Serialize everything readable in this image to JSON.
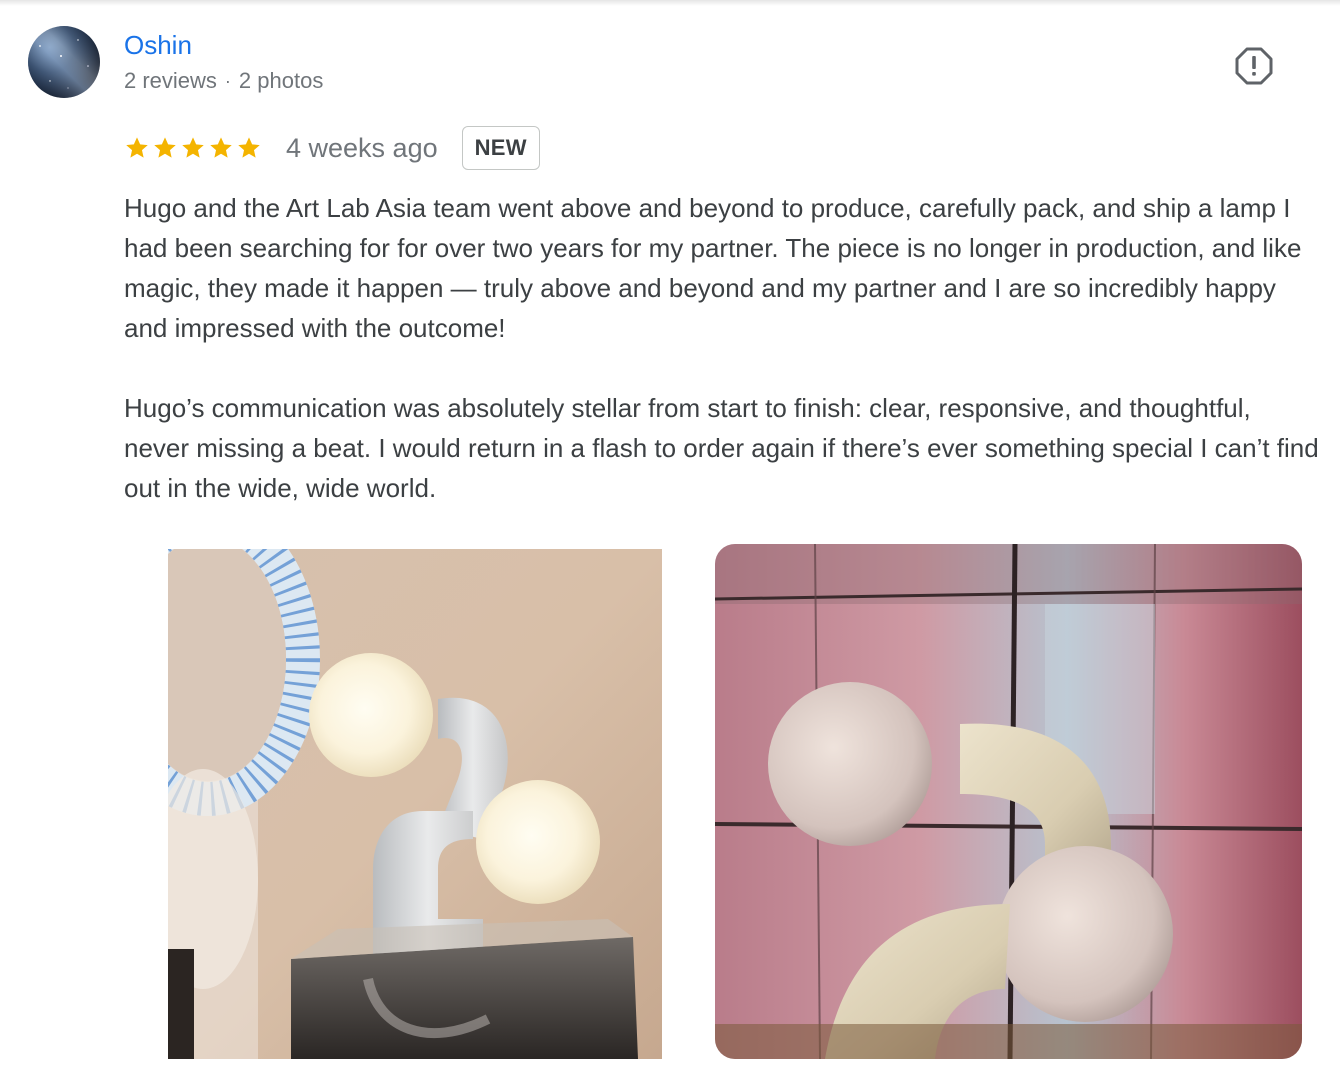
{
  "review": {
    "author": {
      "name": "Oshin",
      "review_count": "2 reviews",
      "separator": "·",
      "photo_count": "2 photos"
    },
    "rating": 5,
    "stars_color": "#f4b400",
    "time_ago": "4 weeks ago",
    "badge": "NEW",
    "paragraphs": [
      "Hugo and the Art Lab Asia team went above and beyond to produce, carefully pack, and ship a lamp I had been searching for for over two years for my partner. The piece is no longer in production, and like magic, they made it happen — truly above and beyond and my partner and I are so incredibly happy and impressed with the outcome!",
      "Hugo’s communication was absolutely stellar from start to finish: clear, responsive, and thoughtful, never missing a beat. I would return in a flash to order again if there’s ever something special I can’t find out in the wide, wide world."
    ],
    "report_icon": "report-icon",
    "photos": [
      {
        "icon": "lamp-photo-staged"
      },
      {
        "icon": "lamp-photo-window"
      }
    ]
  },
  "colors": {
    "author_link": "#1a73e8",
    "secondary_text": "#70757a",
    "body_text": "#3c4043"
  }
}
